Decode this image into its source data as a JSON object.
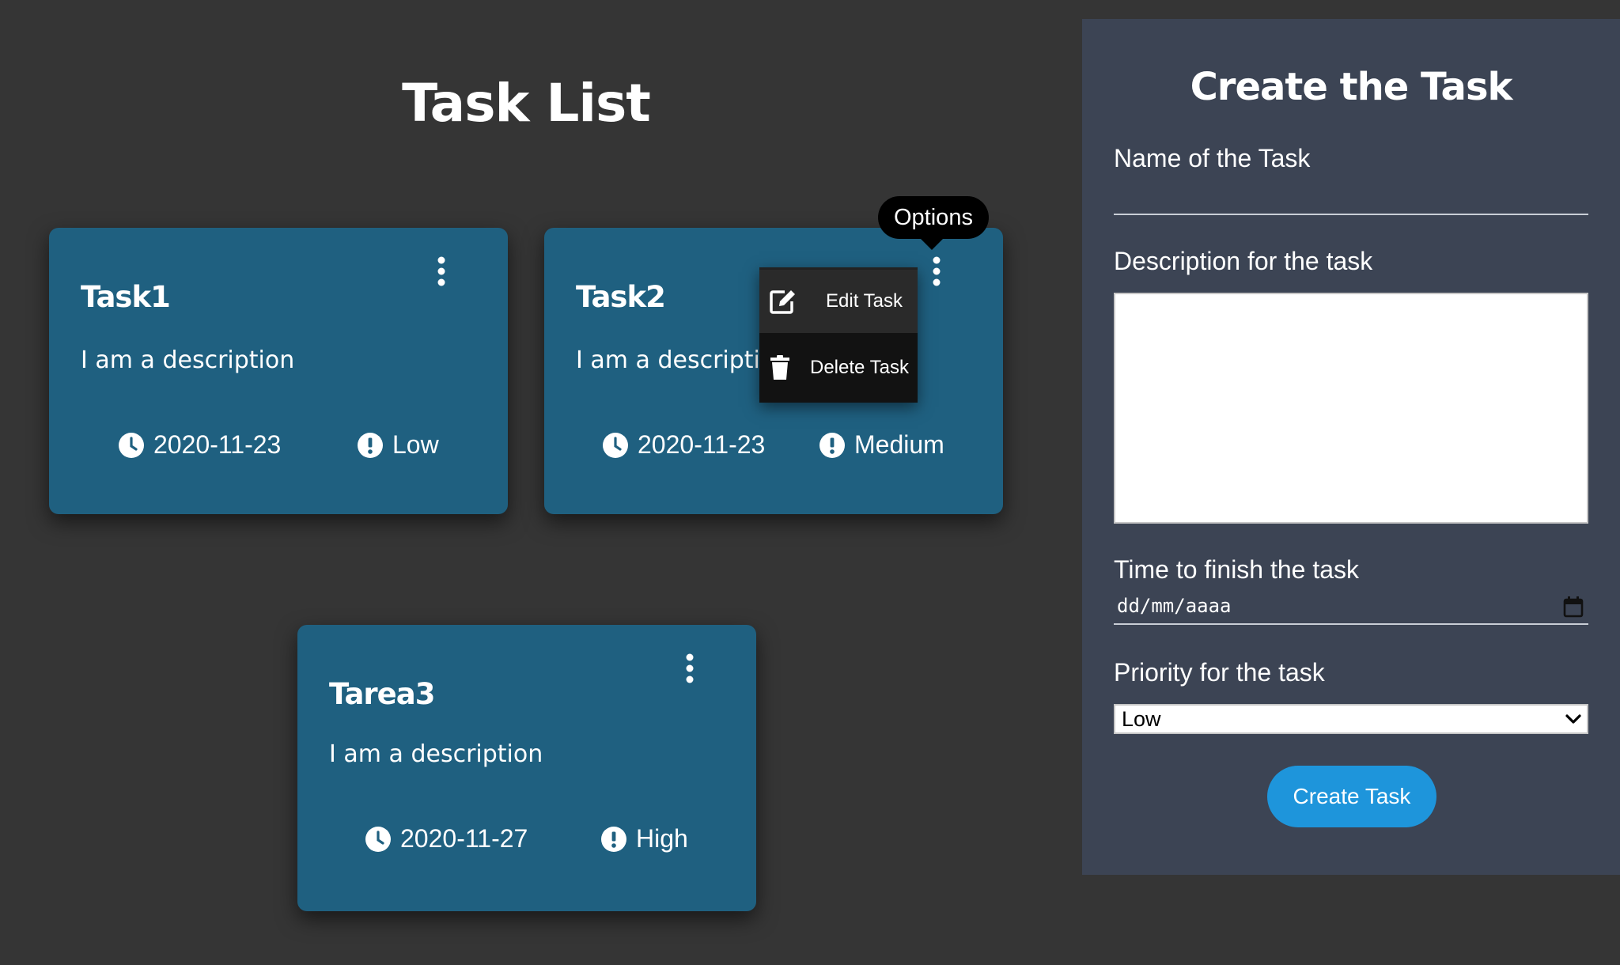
{
  "task_list": {
    "title": "Task List"
  },
  "tasks": [
    {
      "name": "Task1",
      "description": "I am a description",
      "date": "2020-11-23",
      "priority": "Low"
    },
    {
      "name": "Task2",
      "description": "I am a description",
      "date": "2020-11-23",
      "priority": "Medium"
    },
    {
      "name": "Tarea3",
      "description": "I am a description",
      "date": "2020-11-27",
      "priority": "High"
    }
  ],
  "options_tooltip": "Options",
  "context_menu": {
    "edit_label": "Edit Task",
    "delete_label": "Delete Task"
  },
  "create_form": {
    "title": "Create the Task",
    "name_label": "Name of the Task",
    "name_value": "",
    "description_label": "Description for the task",
    "description_value": "",
    "time_label": "Time to finish the task",
    "date_placeholder": "dd/mm/aaaa",
    "priority_label": "Priority for the task",
    "priority_value": "Low",
    "submit_label": "Create Task"
  },
  "icons": {
    "menu": "kebab-menu-icon",
    "date": "clock-icon",
    "priority": "exclamation-circle-icon",
    "edit": "edit-icon",
    "delete": "trash-icon",
    "calendar": "calendar-icon",
    "select": "chevron-down-icon"
  },
  "colors": {
    "background": "#353535",
    "card": "#1f6080",
    "panel": "#3c4454",
    "button": "#1e95db",
    "menu": "#121212"
  }
}
